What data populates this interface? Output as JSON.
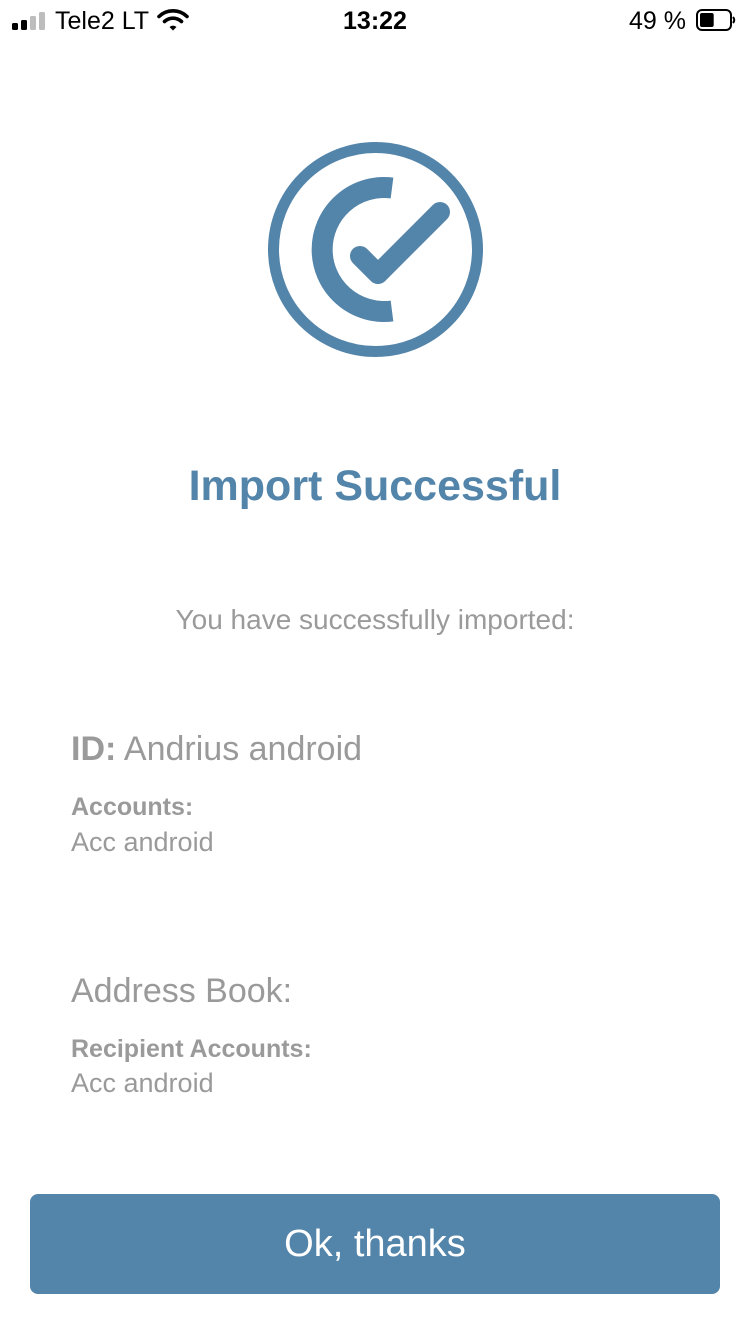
{
  "status_bar": {
    "carrier": "Tele2 LT",
    "time": "13:22",
    "battery_percent_label": "49 %",
    "battery_level": 0.49,
    "signal_bars_active": 2,
    "signal_bars_total": 4
  },
  "logo": {
    "icon": "check-circle-icon",
    "color": "#5384a9"
  },
  "title": "Import Successful",
  "intro": "You have successfully imported:",
  "id_section": {
    "label": "ID:",
    "value": "Andrius android",
    "accounts_label": "Accounts:",
    "accounts_value": "Acc android"
  },
  "address_book": {
    "title": "Address Book:",
    "recipient_label": "Recipient Accounts:",
    "recipient_value": "Acc android"
  },
  "button": {
    "label": "Ok, thanks"
  },
  "colors": {
    "accent": "#5384a9",
    "muted_text": "#9a9a9a"
  }
}
